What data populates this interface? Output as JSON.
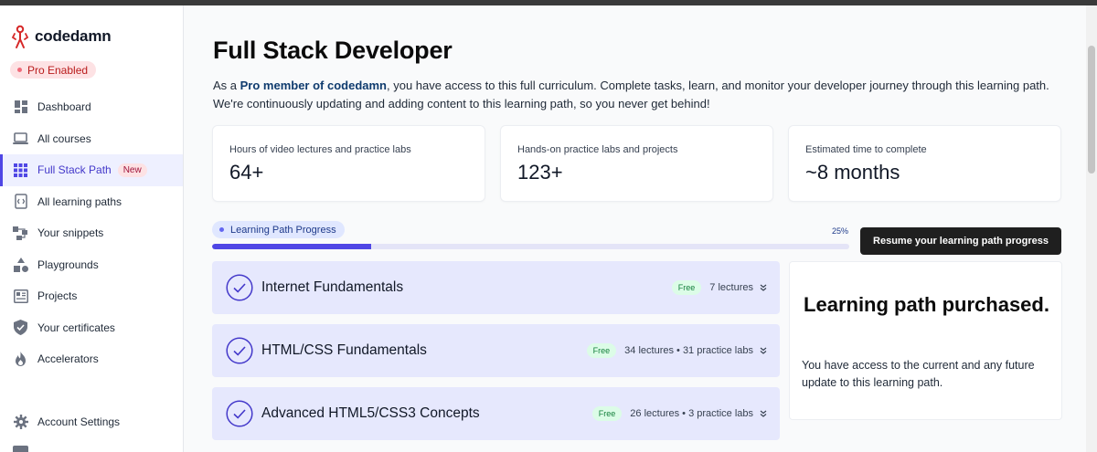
{
  "brand": {
    "name": "codedamn",
    "pro_badge": "Pro Enabled"
  },
  "sidebar": {
    "items": [
      {
        "label": "Dashboard",
        "icon": "dashboard-icon"
      },
      {
        "label": "All courses",
        "icon": "laptop-icon"
      },
      {
        "label": "Full Stack Path",
        "icon": "grid-icon",
        "badge": "New",
        "active": true
      },
      {
        "label": "All learning paths",
        "icon": "code-bracket-icon"
      },
      {
        "label": "Your snippets",
        "icon": "snippet-icon"
      },
      {
        "label": "Playgrounds",
        "icon": "shapes-icon"
      },
      {
        "label": "Projects",
        "icon": "projects-icon"
      },
      {
        "label": "Your certificates",
        "icon": "shield-check-icon"
      },
      {
        "label": "Accelerators",
        "icon": "flame-icon"
      }
    ],
    "bottom": {
      "label": "Account Settings",
      "icon": "gear-icon"
    }
  },
  "main": {
    "title": "Full Stack Developer",
    "intro_before": "As a ",
    "intro_link": "Pro member of codedamn",
    "intro_after": ", you have access to this full curriculum. Complete tasks, learn, and monitor your developer journey through this learning path. We're continuously updating and adding content to this learning path, so you never get behind!",
    "stats": [
      {
        "label": "Hours of video lectures and practice labs",
        "value": "64+"
      },
      {
        "label": "Hands-on practice labs and projects",
        "value": "123+"
      },
      {
        "label": "Estimated time to complete",
        "value": "~8 months"
      }
    ],
    "progress": {
      "label": "Learning Path Progress",
      "percent_text": "25%",
      "percent": 25
    },
    "resume_button": "Resume your learning path progress",
    "modules": [
      {
        "title": "Internet Fundamentals",
        "badge": "Free",
        "meta": "7 lectures"
      },
      {
        "title": "HTML/CSS Fundamentals",
        "badge": "Free",
        "meta": "34 lectures • 31 practice labs"
      },
      {
        "title": "Advanced HTML5/CSS3 Concepts",
        "badge": "Free",
        "meta": "26 lectures • 3 practice labs"
      }
    ],
    "purchased": {
      "title": "Learning path purchased.",
      "text": "You have access to the current and any future update to this learning path."
    }
  },
  "colors": {
    "accent": "#4f46e5",
    "pro_badge_bg": "#fde2e4",
    "module_bg": "#e6e8fd",
    "free_badge": "#dcfce7",
    "button": "#1f1f1f"
  }
}
